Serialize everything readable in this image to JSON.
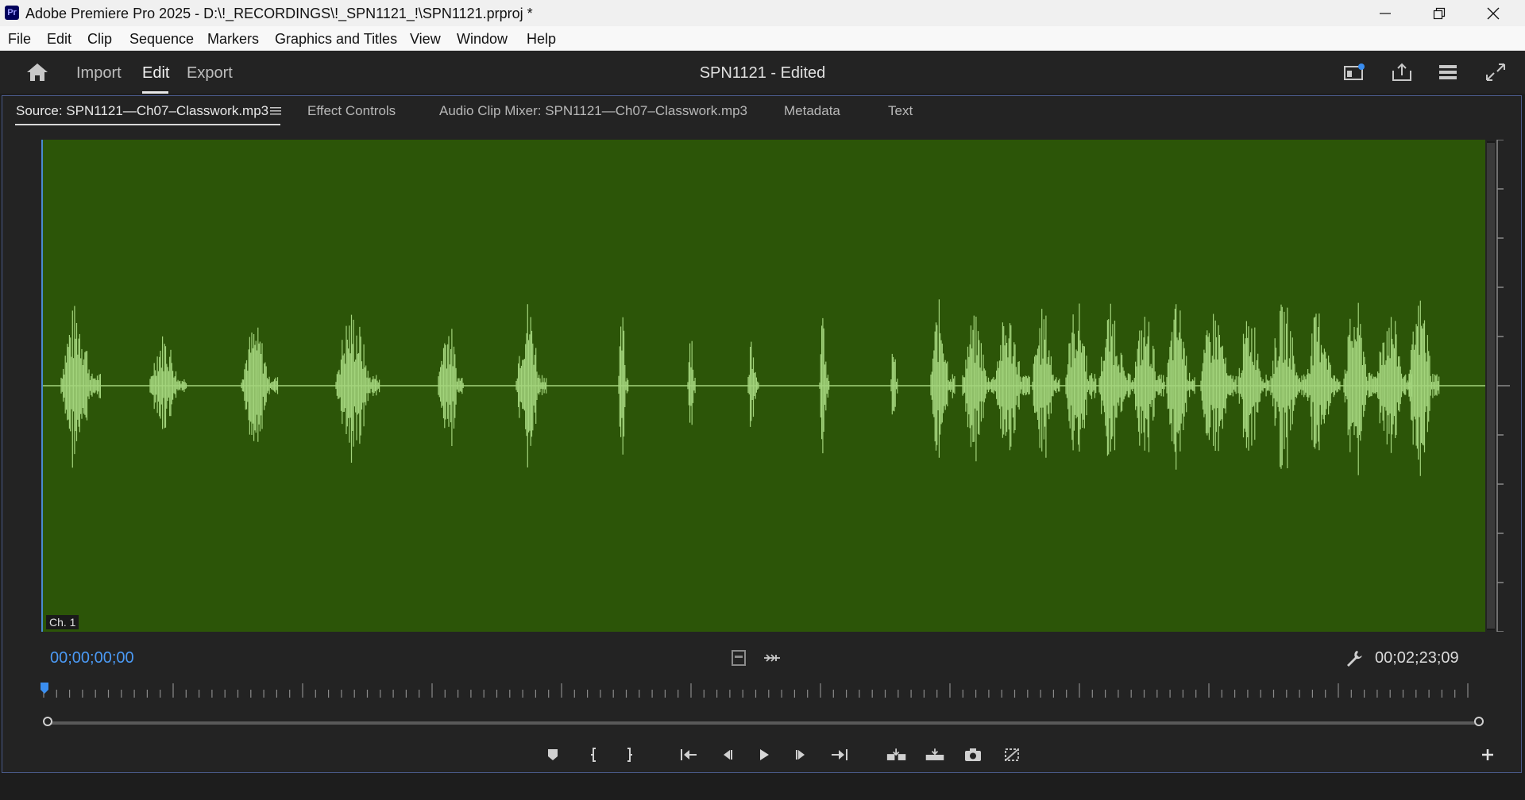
{
  "window": {
    "app_badge": "Pr",
    "title": "Adobe Premiere Pro 2025 - D:\\!_RECORDINGS\\!_SPN1121_!\\SPN1121.prproj *"
  },
  "menu": [
    "File",
    "Edit",
    "Clip",
    "Sequence",
    "Markers",
    "Graphics and Titles",
    "View",
    "Window",
    "Help"
  ],
  "header": {
    "workspace_tabs": [
      "Import",
      "Edit",
      "Export"
    ],
    "active_tab": "Edit",
    "document_title": "SPN1121 - Edited",
    "icons": [
      "panel-layout-icon",
      "share-icon",
      "workspaces-menu-icon",
      "fullscreen-icon"
    ]
  },
  "panel": {
    "tabs": [
      {
        "label": "Source: SPN1121—Ch07–Classwork.mp3",
        "active": true
      },
      {
        "label": "Effect Controls",
        "active": false
      },
      {
        "label": "Audio Clip Mixer: SPN1121—Ch07–Classwork.mp3",
        "active": false
      },
      {
        "label": "Metadata",
        "active": false
      },
      {
        "label": "Text",
        "active": false
      }
    ],
    "channel_label": "Ch. 1",
    "timecode_current": "00;00;00;00",
    "timecode_duration": "00;02;23;09",
    "waveform_color": "#a3d47c",
    "background_color": "#2c5508",
    "accent_color": "#4b9af5"
  },
  "transport": [
    "add-marker-icon",
    "mark-in-icon",
    "mark-out-icon",
    "go-to-in-icon",
    "step-back-icon",
    "play-icon",
    "step-forward-icon",
    "go-to-out-icon",
    "insert-icon",
    "overwrite-icon",
    "export-frame-icon",
    "drag-video-audio-icon",
    "button-editor-icon"
  ]
}
